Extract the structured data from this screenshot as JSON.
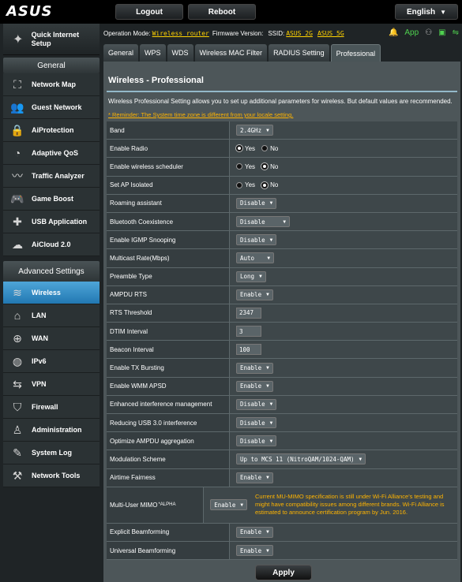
{
  "header": {
    "logo": "ASUS",
    "logout": "Logout",
    "reboot": "Reboot",
    "language": "English"
  },
  "sidebar": {
    "quick_setup": "Quick Internet Setup",
    "general_title": "General",
    "general_items": [
      {
        "label": "Network Map",
        "icon": "network-map-icon"
      },
      {
        "label": "Guest Network",
        "icon": "guest-network-icon"
      },
      {
        "label": "AiProtection",
        "icon": "lock-icon"
      },
      {
        "label": "Adaptive QoS",
        "icon": "gauge-icon"
      },
      {
        "label": "Traffic Analyzer",
        "icon": "traffic-chart-icon"
      },
      {
        "label": "Game Boost",
        "icon": "gamepad-icon"
      },
      {
        "label": "USB Application",
        "icon": "puzzle-icon"
      },
      {
        "label": "AiCloud 2.0",
        "icon": "cloud-icon"
      }
    ],
    "advanced_title": "Advanced Settings",
    "advanced_items": [
      {
        "label": "Wireless",
        "icon": "wifi-icon",
        "active": true
      },
      {
        "label": "LAN",
        "icon": "home-icon"
      },
      {
        "label": "WAN",
        "icon": "globe-icon"
      },
      {
        "label": "IPv6",
        "icon": "ipv6-globe-icon"
      },
      {
        "label": "VPN",
        "icon": "vpn-icon"
      },
      {
        "label": "Firewall",
        "icon": "shield-icon"
      },
      {
        "label": "Administration",
        "icon": "admin-user-icon"
      },
      {
        "label": "System Log",
        "icon": "log-edit-icon"
      },
      {
        "label": "Network Tools",
        "icon": "tools-icon"
      }
    ]
  },
  "status": {
    "operation_mode_label": "Operation Mode:",
    "operation_mode": "Wireless router",
    "firmware_label": "Firmware Version:",
    "ssid_label": "SSID:",
    "ssid_2g": "ASUS_2G",
    "ssid_5g": "ASUS_5G",
    "app_label": "App"
  },
  "tabs": [
    {
      "label": "General"
    },
    {
      "label": "WPS"
    },
    {
      "label": "WDS"
    },
    {
      "label": "Wireless MAC Filter"
    },
    {
      "label": "RADIUS Setting"
    },
    {
      "label": "Professional",
      "active": true
    }
  ],
  "page": {
    "title": "Wireless - Professional",
    "description": "Wireless Professional Setting allows you to set up additional parameters for wireless. But default values are recommended.",
    "reminder": "* Reminder: The System time zone is different from your locale setting."
  },
  "settings": {
    "band": {
      "label": "Band",
      "value": "2.4GHz"
    },
    "enable_radio": {
      "label": "Enable Radio",
      "yes": "Yes",
      "no": "No"
    },
    "scheduler": {
      "label": "Enable wireless scheduler",
      "yes": "Yes",
      "no": "No"
    },
    "ap_isolated": {
      "label": "Set AP Isolated",
      "yes": "Yes",
      "no": "No"
    },
    "roaming": {
      "label": "Roaming assistant",
      "value": "Disable"
    },
    "bluetooth": {
      "label": "Bluetooth Coexistence",
      "value": "Disable"
    },
    "igmp": {
      "label": "Enable IGMP Snooping",
      "value": "Disable"
    },
    "multicast": {
      "label": "Multicast Rate(Mbps)",
      "value": "Auto"
    },
    "preamble": {
      "label": "Preamble Type",
      "value": "Long"
    },
    "ampdu_rts": {
      "label": "AMPDU RTS",
      "value": "Enable"
    },
    "rts_threshold": {
      "label": "RTS Threshold",
      "value": "2347"
    },
    "dtim": {
      "label": "DTIM Interval",
      "value": "3"
    },
    "beacon": {
      "label": "Beacon Interval",
      "value": "100"
    },
    "tx_bursting": {
      "label": "Enable TX Bursting",
      "value": "Enable"
    },
    "wmm_apsd": {
      "label": "Enable WMM APSD",
      "value": "Enable"
    },
    "interference": {
      "label": "Enhanced interference management",
      "value": "Disable"
    },
    "usb3": {
      "label": "Reducing USB 3.0 interference",
      "value": "Disable"
    },
    "ampdu_agg": {
      "label": "Optimize AMPDU aggregation",
      "value": "Disable"
    },
    "modulation": {
      "label": "Modulation Scheme",
      "value": "Up to MCS 11 (NitroQAM/1024-QAM)"
    },
    "airtime": {
      "label": "Airtime Fairness",
      "value": "Enable"
    },
    "mumimo": {
      "label": "Multi-User MIMO",
      "sup": "*ALPHA",
      "value": "Enable",
      "note": "Current MU-MIMO specification is still under Wi-Fi Alliance's testing and might have compatibility issues among different brands. Wi-Fi Alliance is estimated to announce certification program by Jun. 2016."
    },
    "explicit_bf": {
      "label": "Explicit Beamforming",
      "value": "Enable"
    },
    "universal_bf": {
      "label": "Universal Beamforming",
      "value": "Enable"
    }
  },
  "apply": "Apply"
}
